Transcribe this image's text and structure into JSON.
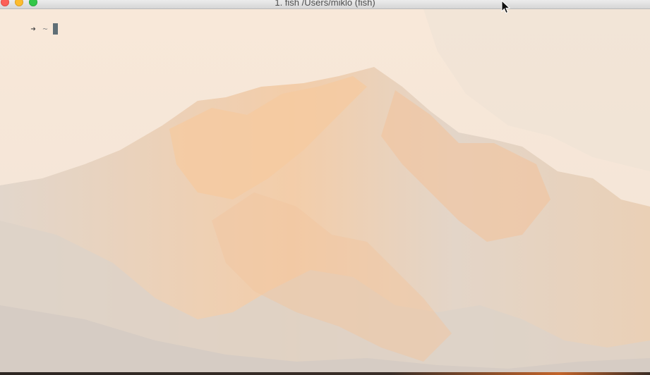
{
  "window": {
    "title": "1. fish  /Users/miklo (fish)"
  },
  "terminal": {
    "prompt_arrow": "➜",
    "prompt_cwd": "~",
    "input": ""
  },
  "colors": {
    "close": "#fc5f57",
    "minimize": "#fdbc2e",
    "maximize": "#33c748",
    "cursor": "#5f6e76",
    "background": "#f6e6d6"
  },
  "icons": {
    "pointer": "mouse-pointer-icon"
  }
}
